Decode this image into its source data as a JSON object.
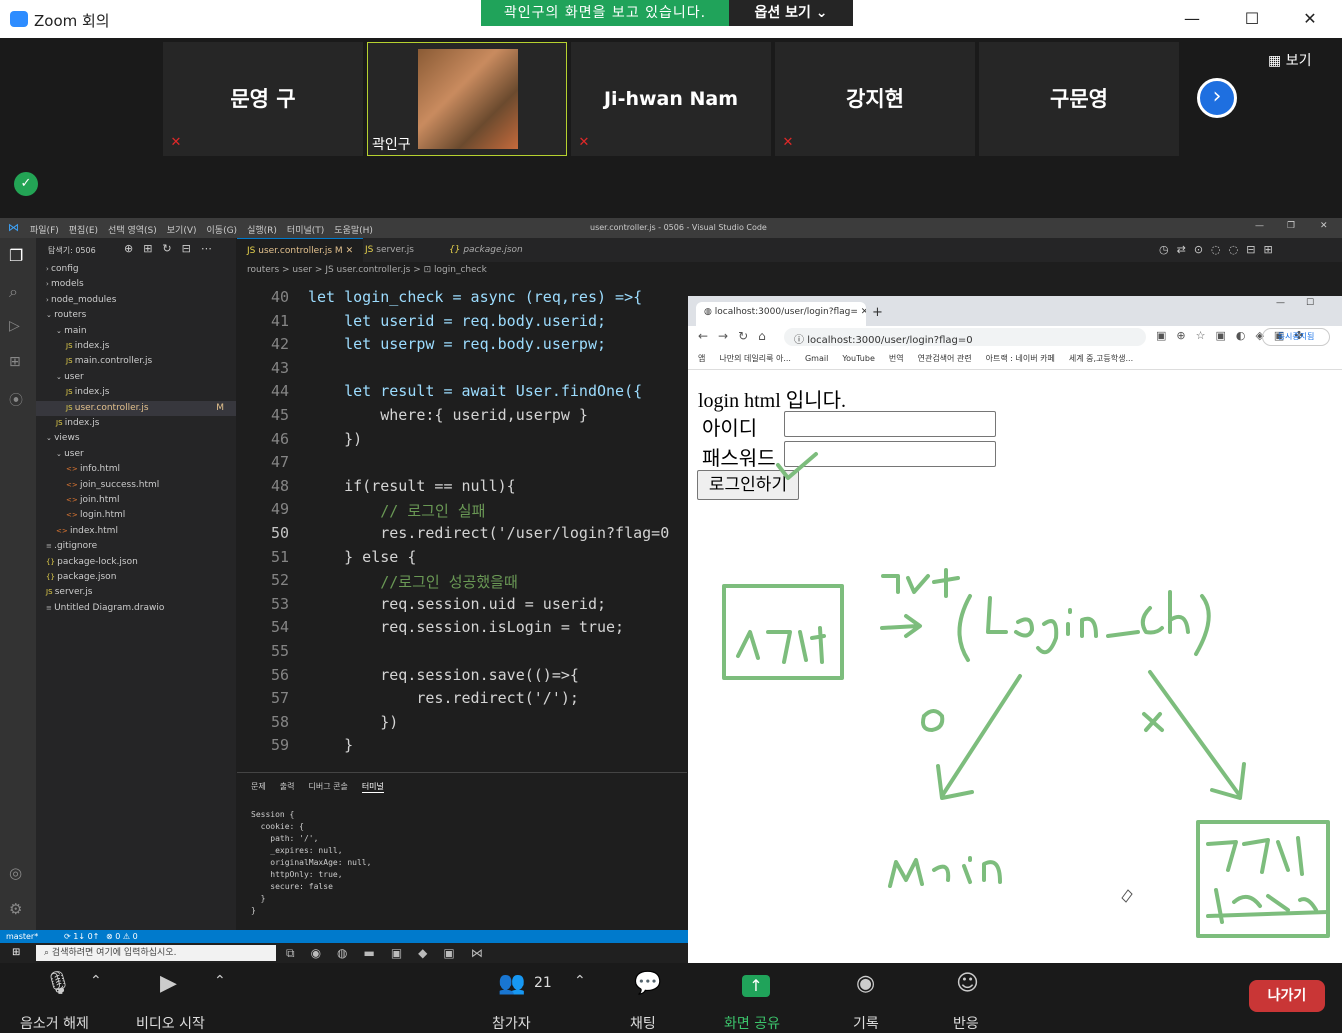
{
  "zoom": {
    "window_title": "Zoom 회의",
    "share_banner": "곽인구의 화면을 보고 있습니다.",
    "options_label": "옵션 보기",
    "view_label": "보기",
    "participants": [
      {
        "name": "문영 구",
        "muted": true
      },
      {
        "name": "곽인구",
        "muted": false,
        "has_video": true
      },
      {
        "name": "Ji-hwan Nam",
        "muted": true
      },
      {
        "name": "강지현",
        "muted": true
      },
      {
        "name": "구문영",
        "muted": false
      }
    ],
    "toolbar": {
      "unmute": "음소거 해제",
      "start_video": "비디오 시작",
      "participants": "참가자",
      "participant_count": "21",
      "chat": "채팅",
      "share_screen": "화면 공유",
      "record": "기록",
      "reactions": "반응",
      "leave": "나가기"
    }
  },
  "vscode": {
    "title": "user.controller.js - 0506 - Visual Studio Code",
    "menu": [
      "파일(F)",
      "편집(E)",
      "선택 영역(S)",
      "보기(V)",
      "이동(G)",
      "실행(R)",
      "터미널(T)",
      "도움말(H)"
    ],
    "explorer_title": "탐색기: 0506",
    "tree": [
      {
        "label": "config",
        "depth": 0,
        "kind": "folder"
      },
      {
        "label": "models",
        "depth": 0,
        "kind": "folder"
      },
      {
        "label": "node_modules",
        "depth": 0,
        "kind": "folder"
      },
      {
        "label": "routers",
        "depth": 0,
        "kind": "folder-open"
      },
      {
        "label": "main",
        "depth": 1,
        "kind": "folder-open"
      },
      {
        "label": "index.js",
        "depth": 2,
        "kind": "js"
      },
      {
        "label": "main.controller.js",
        "depth": 2,
        "kind": "js"
      },
      {
        "label": "user",
        "depth": 1,
        "kind": "folder-open"
      },
      {
        "label": "index.js",
        "depth": 2,
        "kind": "js"
      },
      {
        "label": "user.controller.js",
        "depth": 2,
        "kind": "js",
        "badge": "M"
      },
      {
        "label": "index.js",
        "depth": 1,
        "kind": "js"
      },
      {
        "label": "views",
        "depth": 0,
        "kind": "folder-open"
      },
      {
        "label": "user",
        "depth": 1,
        "kind": "folder-open"
      },
      {
        "label": "info.html",
        "depth": 2,
        "kind": "html"
      },
      {
        "label": "join_success.html",
        "depth": 2,
        "kind": "html"
      },
      {
        "label": "join.html",
        "depth": 2,
        "kind": "html"
      },
      {
        "label": "login.html",
        "depth": 2,
        "kind": "html"
      },
      {
        "label": "index.html",
        "depth": 1,
        "kind": "html"
      },
      {
        "label": ".gitignore",
        "depth": 0,
        "kind": "file"
      },
      {
        "label": "package-lock.json",
        "depth": 0,
        "kind": "json"
      },
      {
        "label": "package.json",
        "depth": 0,
        "kind": "json"
      },
      {
        "label": "server.js",
        "depth": 0,
        "kind": "js"
      },
      {
        "label": "Untitled Diagram.drawio",
        "depth": 0,
        "kind": "file"
      }
    ],
    "tabs": [
      "user.controller.js M",
      "server.js",
      "package.json"
    ],
    "breadcrumb": "routers > user > JS user.controller.js > ⊡ login_check",
    "code_lines": [
      {
        "n": "40",
        "text": "let login_check = async (req,res) =>{"
      },
      {
        "n": "41",
        "text": "    let userid = req.body.userid;"
      },
      {
        "n": "42",
        "text": "    let userpw = req.body.userpw;"
      },
      {
        "n": "43",
        "text": ""
      },
      {
        "n": "44",
        "text": "    let result = await User.findOne({"
      },
      {
        "n": "45",
        "text": "        where:{ userid,userpw }"
      },
      {
        "n": "46",
        "text": "    })"
      },
      {
        "n": "47",
        "text": ""
      },
      {
        "n": "48",
        "text": "    if(result == null){"
      },
      {
        "n": "49",
        "text": "        // 로그인 실패"
      },
      {
        "n": "50",
        "text": "        res.redirect('/user/login?flag=0"
      },
      {
        "n": "51",
        "text": "    } else {"
      },
      {
        "n": "52",
        "text": "        //로그인 성공했을때"
      },
      {
        "n": "53",
        "text": "        req.session.uid = userid;"
      },
      {
        "n": "54",
        "text": "        req.session.isLogin = true;"
      },
      {
        "n": "55",
        "text": ""
      },
      {
        "n": "56",
        "text": "        req.session.save(()=>{"
      },
      {
        "n": "57",
        "text": "            res.redirect('/');"
      },
      {
        "n": "58",
        "text": "        })"
      },
      {
        "n": "59",
        "text": "    }"
      }
    ],
    "panel_tabs": [
      "문제",
      "출력",
      "디버그 콘솔",
      "터미널"
    ],
    "terminal_lines": [
      "Session {",
      "  cookie: {",
      "    path: '/',",
      "    _expires: null,",
      "    originalMaxAge: null,",
      "    httpOnly: true,",
      "    secure: false",
      "  }",
      "}"
    ],
    "status": {
      "branch": "master*",
      "sync": "⟳ 1↓ 0↑",
      "problems": "⊗ 0 ⚠ 0"
    },
    "taskbar_search": "검색하려면 여기에 입력하십시오."
  },
  "browser": {
    "tab_title": "localhost:3000/user/login?flag=",
    "url": "localhost:3000/user/login?flag=0",
    "profile": "동시중지됨",
    "bookmarks": [
      "앱",
      "나만의 데일리룩 아...",
      "Gmail",
      "YouTube",
      "번역",
      "연관검색어 관련",
      "아트랙 : 네이버 카페",
      "세계 중,고등학생..."
    ],
    "page": {
      "heading": "login html 입니다.",
      "id_label": "아이디",
      "pw_label": "패스워드",
      "submit": "로그인하기"
    }
  },
  "colors": {
    "zoom_green": "#20a35a",
    "leave_red": "#c93636",
    "vscode_blue": "#007acc",
    "annotation_green": "#7dbd7d"
  }
}
